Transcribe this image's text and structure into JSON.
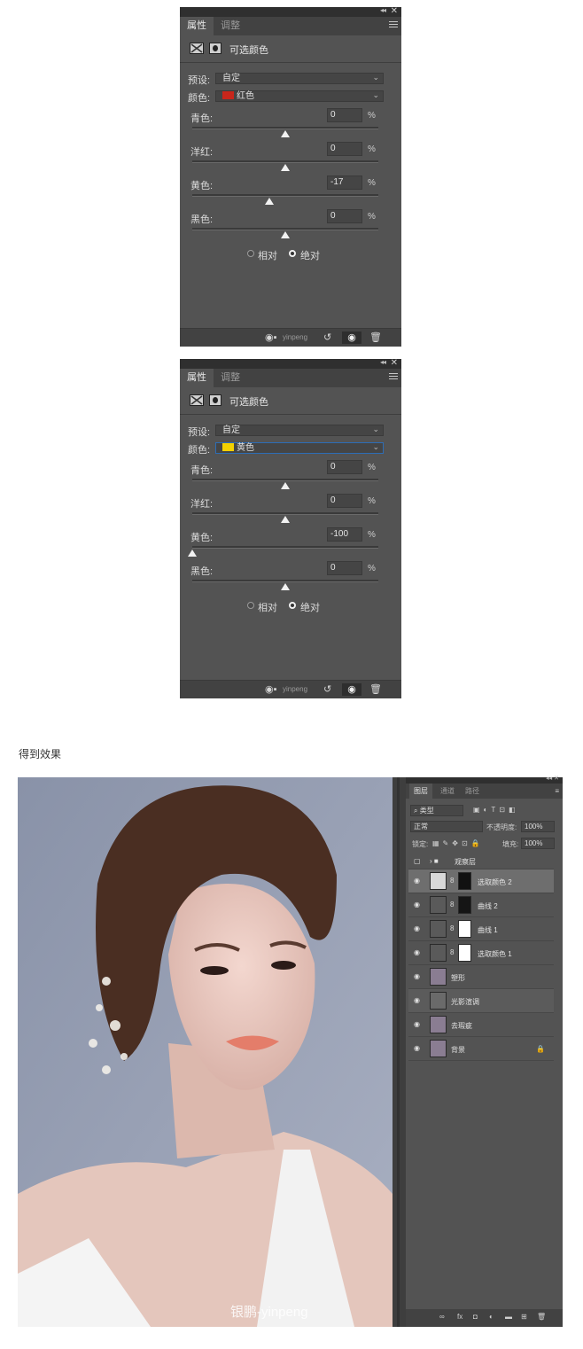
{
  "panels": [
    {
      "tabs": [
        "属性",
        "调整"
      ],
      "title": "可选颜色",
      "preset_label": "预设:",
      "preset_value": "自定",
      "color_label": "颜色:",
      "color_value": "红色",
      "color_swatch": "#c8261b",
      "sliders": [
        {
          "label": "青色:",
          "value": "0",
          "unit": "%",
          "percent": 0
        },
        {
          "label": "洋红:",
          "value": "0",
          "unit": "%",
          "percent": 0
        },
        {
          "label": "黄色:",
          "value": "-17",
          "unit": "%",
          "percent": -17
        },
        {
          "label": "黑色:",
          "value": "0",
          "unit": "%",
          "percent": 0
        }
      ],
      "mode_relative": "相对",
      "mode_absolute": "绝对",
      "selected_mode": "absolute",
      "watermark": "yinpeng"
    },
    {
      "tabs": [
        "属性",
        "调整"
      ],
      "title": "可选颜色",
      "preset_label": "预设:",
      "preset_value": "自定",
      "color_label": "颜色:",
      "color_value": "黄色",
      "color_swatch": "#f3d100",
      "sliders": [
        {
          "label": "青色:",
          "value": "0",
          "unit": "%",
          "percent": 0
        },
        {
          "label": "洋红:",
          "value": "0",
          "unit": "%",
          "percent": 0
        },
        {
          "label": "黄色:",
          "value": "-100",
          "unit": "%",
          "percent": -100
        },
        {
          "label": "黑色:",
          "value": "0",
          "unit": "%",
          "percent": 0
        }
      ],
      "mode_relative": "相对",
      "mode_absolute": "绝对",
      "selected_mode": "absolute",
      "watermark": "yinpeng"
    }
  ],
  "result_title": "得到效果",
  "photo_watermark": "银鹏-yinpeng",
  "layers_panel": {
    "tabs": [
      "图层",
      "通道",
      "路径"
    ],
    "filter_label": "类型",
    "blend_mode": "正常",
    "opacity_label": "不透明度:",
    "opacity_value": "100%",
    "lock_label": "锁定:",
    "fill_label": "填充:",
    "fill_value": "100%",
    "layers": [
      {
        "name": "观察层",
        "kind": "group"
      },
      {
        "name": "选取颜色 2",
        "kind": "adjustment"
      },
      {
        "name": "曲线 2",
        "kind": "curves"
      },
      {
        "name": "曲线 1",
        "kind": "curves"
      },
      {
        "name": "选取颜色 1",
        "kind": "adjustment"
      },
      {
        "name": "塑形",
        "kind": "photo"
      },
      {
        "name": "光影渲调",
        "kind": "gray"
      },
      {
        "name": "去瑕疵",
        "kind": "photo"
      },
      {
        "name": "背景",
        "kind": "photo"
      }
    ]
  },
  "colors": {
    "panel_bg": "#535353",
    "tabbar_bg": "#424242",
    "focus_border": "#2d6db5"
  }
}
